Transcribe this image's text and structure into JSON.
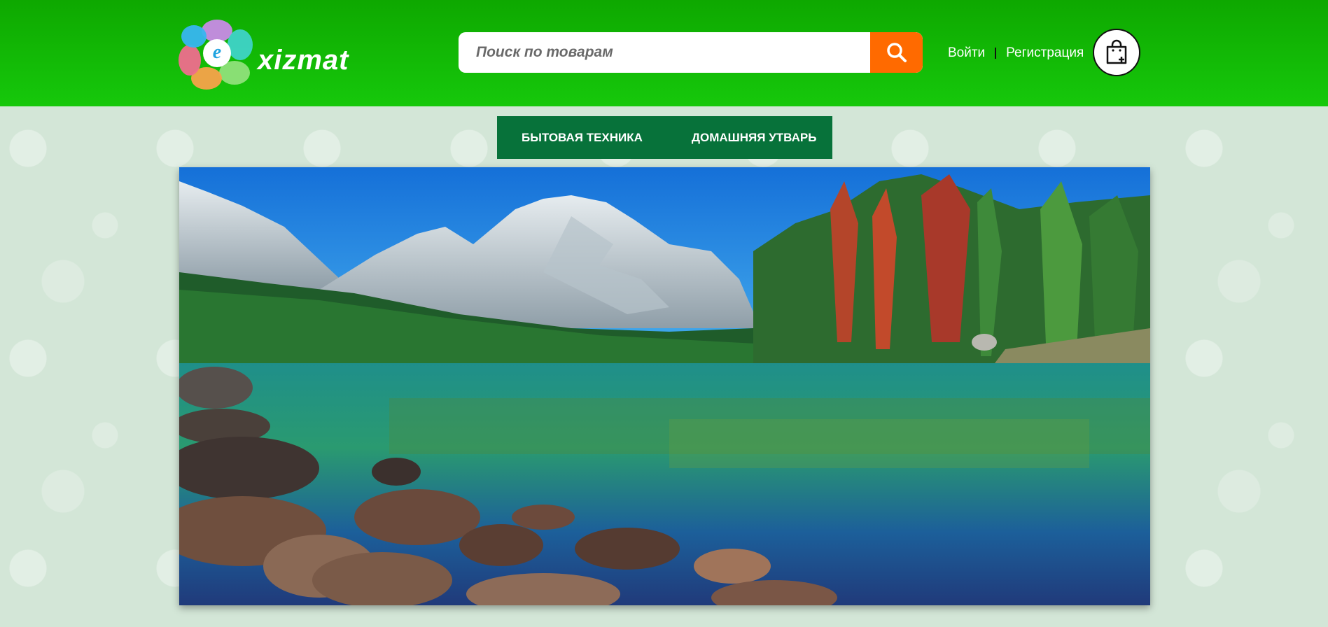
{
  "header": {
    "logo": {
      "letter": "e",
      "text": "xizmat"
    },
    "search": {
      "placeholder": "Поиск по товарам",
      "value": ""
    },
    "auth": {
      "login": "Войти",
      "register": "Регистрация"
    },
    "colors": {
      "header_green": "#12b806",
      "search_button": "#ff6a00",
      "nav_green": "#07723a"
    }
  },
  "nav": {
    "items": [
      {
        "label": "БЫТОВАЯ ТЕХНИКА"
      },
      {
        "label": "ДОМАШНЯЯ УТВАРЬ"
      }
    ]
  },
  "banner": {
    "image": "mountain-lake-landscape"
  }
}
